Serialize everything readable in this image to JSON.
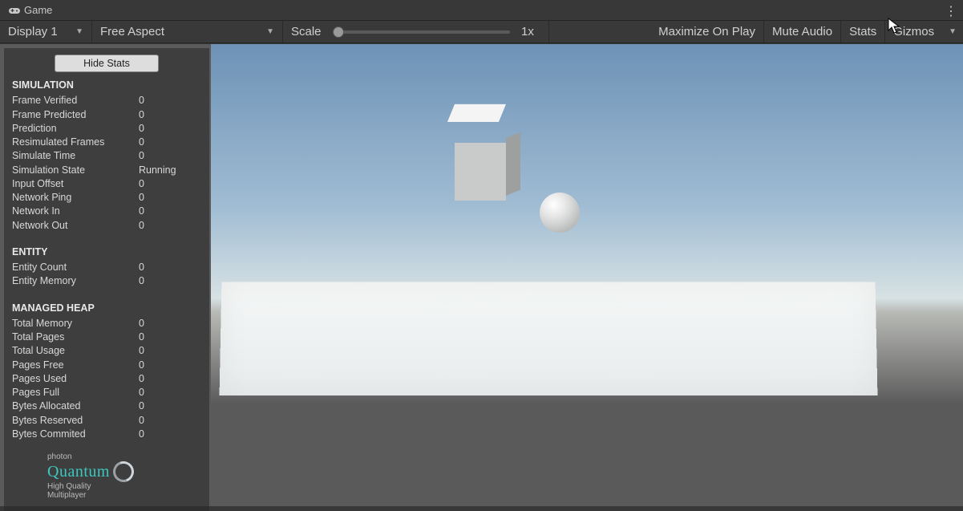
{
  "tab": {
    "label": "Game"
  },
  "toolbar": {
    "display": "Display 1",
    "aspect": "Free Aspect",
    "scale_label": "Scale",
    "scale_value": "1x",
    "maximize": "Maximize On Play",
    "mute": "Mute Audio",
    "stats": "Stats",
    "gizmos": "Gizmos"
  },
  "panel": {
    "hide_btn": "Hide Stats",
    "sections": {
      "simulation": {
        "header": "SIMULATION",
        "rows": [
          {
            "label": "Frame Verified",
            "value": "0"
          },
          {
            "label": "Frame Predicted",
            "value": "0"
          },
          {
            "label": "Prediction",
            "value": "0"
          },
          {
            "label": "Resimulated Frames",
            "value": "0"
          },
          {
            "label": "Simulate Time",
            "value": "0"
          },
          {
            "label": "Simulation State",
            "value": "Running"
          },
          {
            "label": "Input Offset",
            "value": "0"
          },
          {
            "label": "Network Ping",
            "value": "0"
          },
          {
            "label": "Network In",
            "value": "0"
          },
          {
            "label": "Network Out",
            "value": "0"
          }
        ]
      },
      "entity": {
        "header": "ENTITY",
        "rows": [
          {
            "label": "Entity Count",
            "value": "0"
          },
          {
            "label": "Entity Memory",
            "value": "0"
          }
        ]
      },
      "heap": {
        "header": "MANAGED HEAP",
        "rows": [
          {
            "label": "Total Memory",
            "value": "0"
          },
          {
            "label": "Total Pages",
            "value": "0"
          },
          {
            "label": "Total Usage",
            "value": "0"
          },
          {
            "label": "Pages Free",
            "value": "0"
          },
          {
            "label": "Pages Used",
            "value": "0"
          },
          {
            "label": "Pages Full",
            "value": "0"
          },
          {
            "label": "Bytes Allocated",
            "value": "0"
          },
          {
            "label": "Bytes Reserved",
            "value": "0"
          },
          {
            "label": "Bytes Commited",
            "value": "0"
          }
        ]
      }
    },
    "logo": {
      "brand": "photon",
      "product": "Quantum",
      "tag1": "High Quality",
      "tag2": "Multiplayer"
    }
  }
}
